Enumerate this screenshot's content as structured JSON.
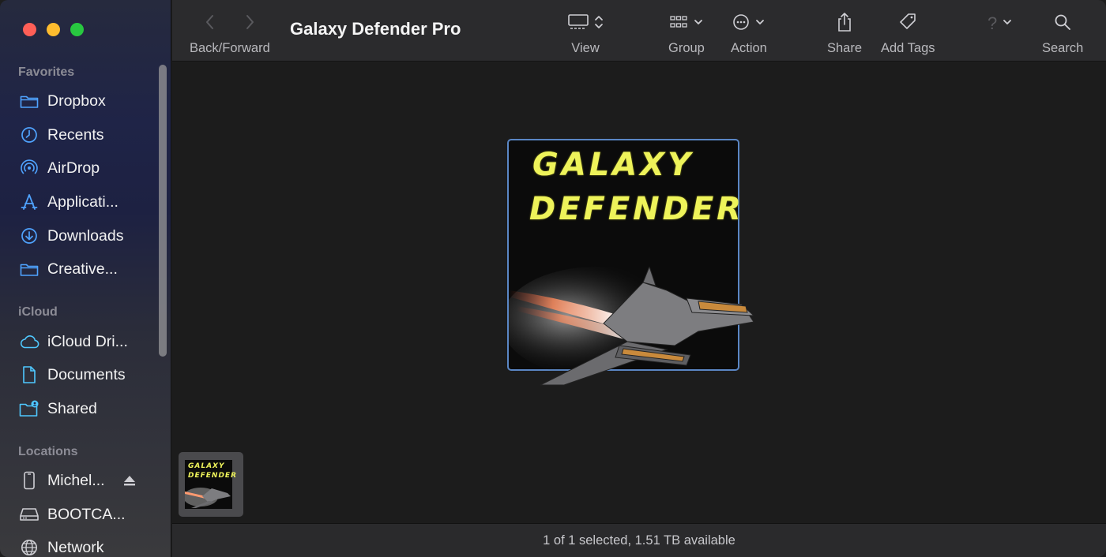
{
  "window": {
    "title": "Galaxy Defender Pro"
  },
  "sidebar": {
    "sections": [
      {
        "label": "Favorites",
        "items": [
          {
            "label": "Dropbox",
            "icon": "folder-icon"
          },
          {
            "label": "Recents",
            "icon": "clock-icon"
          },
          {
            "label": "AirDrop",
            "icon": "airdrop-icon"
          },
          {
            "label": "Applicati...",
            "icon": "applications-icon"
          },
          {
            "label": "Downloads",
            "icon": "download-icon"
          },
          {
            "label": "Creative...",
            "icon": "folder-icon"
          }
        ]
      },
      {
        "label": "iCloud",
        "items": [
          {
            "label": "iCloud Dri...",
            "icon": "cloud-icon"
          },
          {
            "label": "Documents",
            "icon": "document-icon"
          },
          {
            "label": "Shared",
            "icon": "shared-folder-icon"
          }
        ]
      },
      {
        "label": "Locations",
        "items": [
          {
            "label": "Michel...",
            "icon": "phone-icon"
          },
          {
            "label": "BOOTCA...",
            "icon": "drive-icon"
          },
          {
            "label": "Network",
            "icon": "globe-icon"
          }
        ]
      }
    ]
  },
  "toolbar": {
    "back_forward": "Back/Forward",
    "view": "View",
    "group": "Group",
    "action": "Action",
    "share": "Share",
    "add_tags": "Add Tags",
    "help": "?",
    "search": "Search"
  },
  "content": {
    "preview_title_line1": "GALAXY",
    "preview_title_line2": "DEFENDER",
    "thumb_title_line1": "GALAXY",
    "thumb_title_line2": "DEFENDER"
  },
  "status": {
    "text": "1 of 1 selected, 1.51 TB available"
  },
  "colors": {
    "accent": "#4fa3ff",
    "selection_border": "#5a86c4",
    "title_yellow": "#eef35a"
  }
}
